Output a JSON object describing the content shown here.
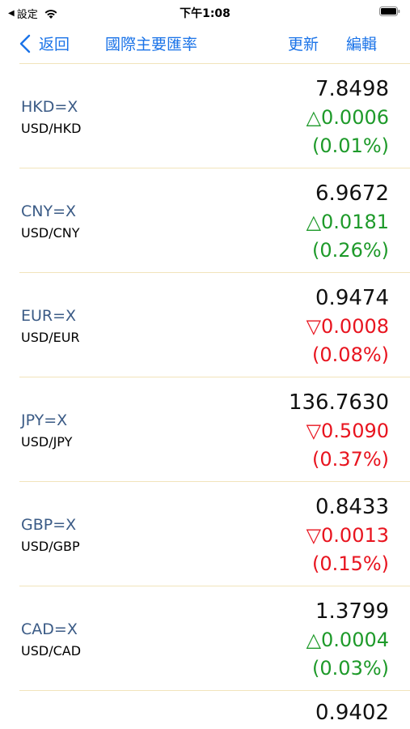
{
  "status_bar": {
    "back_app": "設定",
    "time": "下午1:08"
  },
  "nav": {
    "back_label": "返回",
    "title": "國際主要匯率",
    "refresh_label": "更新",
    "edit_label": "編輯"
  },
  "rates": [
    {
      "symbol": "HKD=X",
      "pair": "USD/HKD",
      "price": "7.8498",
      "change": "△0.0006",
      "pct": "(0.01%)",
      "direction": "up"
    },
    {
      "symbol": "CNY=X",
      "pair": "USD/CNY",
      "price": "6.9672",
      "change": "△0.0181",
      "pct": "(0.26%)",
      "direction": "up"
    },
    {
      "symbol": "EUR=X",
      "pair": "USD/EUR",
      "price": "0.9474",
      "change": "▽0.0008",
      "pct": "(0.08%)",
      "direction": "down"
    },
    {
      "symbol": "JPY=X",
      "pair": "USD/JPY",
      "price": "136.7630",
      "change": "▽0.5090",
      "pct": "(0.37%)",
      "direction": "down"
    },
    {
      "symbol": "GBP=X",
      "pair": "USD/GBP",
      "price": "0.8433",
      "change": "▽0.0013",
      "pct": "(0.15%)",
      "direction": "down"
    },
    {
      "symbol": "CAD=X",
      "pair": "USD/CAD",
      "price": "1.3799",
      "change": "△0.0004",
      "pct": "(0.03%)",
      "direction": "up"
    }
  ],
  "partial_row_price": "0.9402",
  "colors": {
    "accent": "#1a73e8",
    "up": "#1e9a2a",
    "down": "#e8141f",
    "separator": "#f1e4bb",
    "symbol": "#3b5b86"
  }
}
